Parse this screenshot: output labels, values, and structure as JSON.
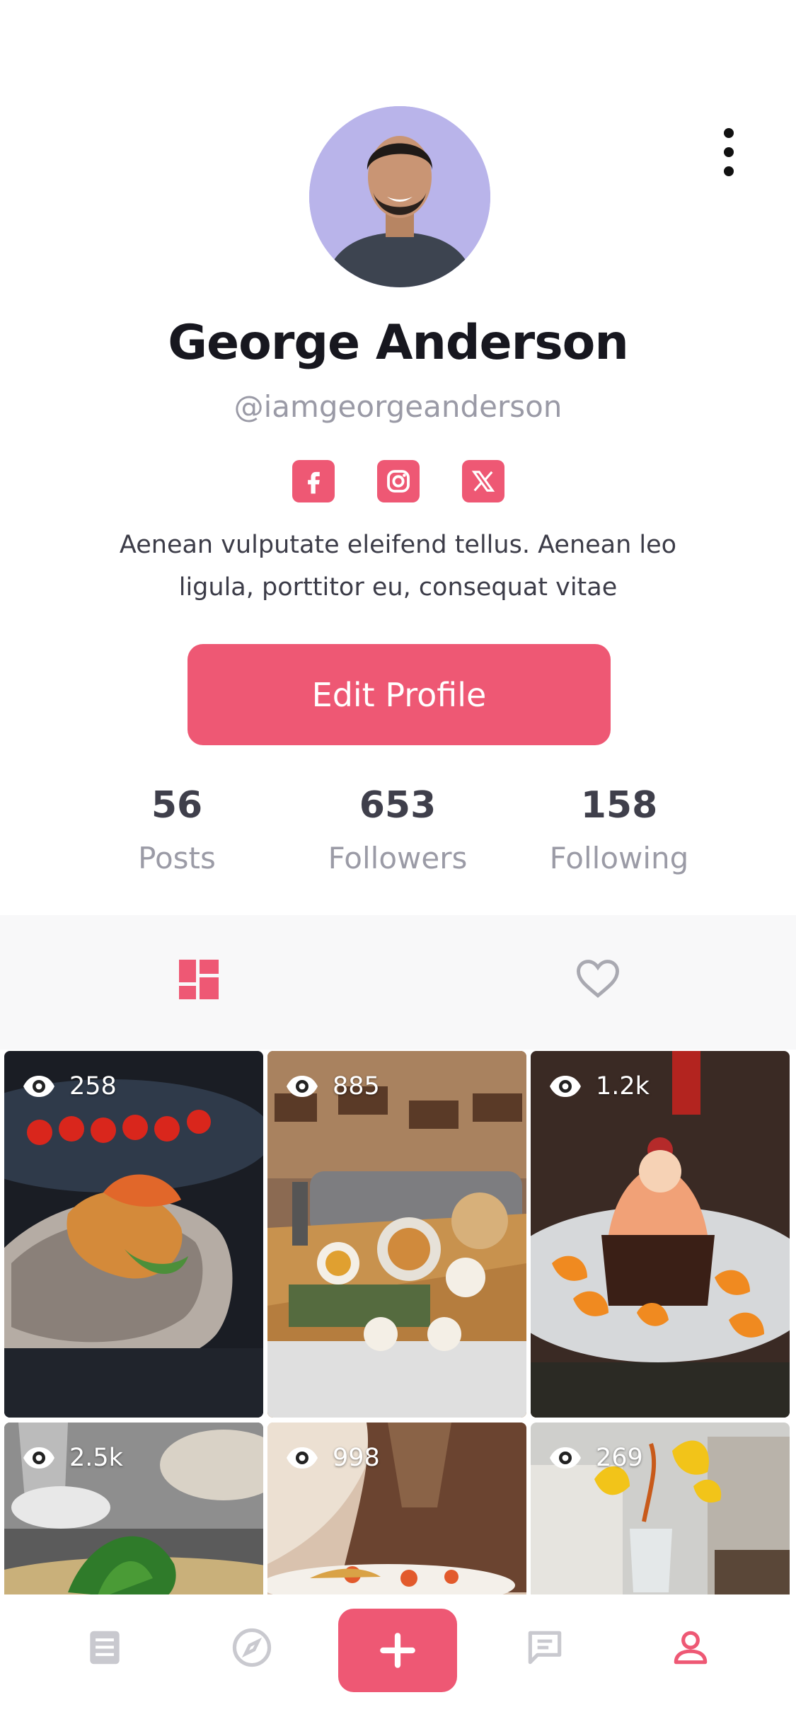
{
  "profile": {
    "name": "George Anderson",
    "handle": "@iamgeorgeanderson",
    "bio": "Aenean vulputate eleifend tellus. Aenean leo ligula, porttitor eu, consequat vitae"
  },
  "socials": [
    {
      "icon": "facebook-icon"
    },
    {
      "icon": "instagram-icon"
    },
    {
      "icon": "x-icon"
    }
  ],
  "edit_button_label": "Edit Profile",
  "stats": [
    {
      "value": "56",
      "label": "Posts"
    },
    {
      "value": "653",
      "label": "Followers"
    },
    {
      "value": "158",
      "label": "Following"
    }
  ],
  "tabs": [
    {
      "icon": "grid-icon",
      "active": true
    },
    {
      "icon": "heart-icon",
      "active": false
    }
  ],
  "posts": [
    {
      "views": "258"
    },
    {
      "views": "885"
    },
    {
      "views": "1.2k"
    },
    {
      "views": "2.5k"
    },
    {
      "views": "998"
    },
    {
      "views": "269"
    }
  ],
  "bottom_nav": [
    {
      "icon": "feed-icon",
      "active": false
    },
    {
      "icon": "compass-icon",
      "active": false
    },
    {
      "icon": "add-icon",
      "active": false
    },
    {
      "icon": "chat-icon",
      "active": false
    },
    {
      "icon": "profile-icon",
      "active": true
    }
  ],
  "colors": {
    "accent": "#ee5874",
    "muted": "#9b9ba6",
    "text": "#17171f"
  }
}
